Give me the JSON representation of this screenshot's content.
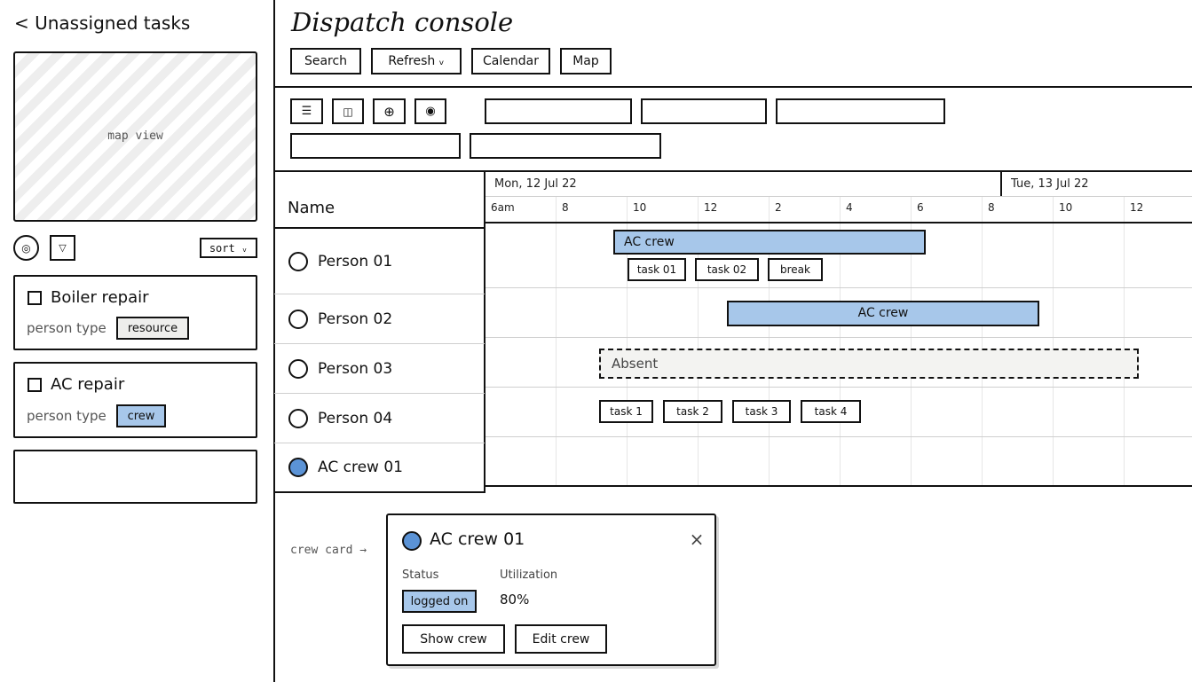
{
  "left": {
    "title": "< Unassigned tasks",
    "map_label": "map view",
    "sort_label": "sort ᵥ",
    "tasks": [
      {
        "name": "Boiler repair",
        "field_label": "person type",
        "tag": "resource",
        "tag_color": "#eeeeec"
      },
      {
        "name": "AC repair",
        "field_label": "person type",
        "tag": "crew",
        "tag_color": "#a7c7ea"
      }
    ]
  },
  "header": {
    "title": "Dispatch console",
    "buttons": {
      "search": "Search",
      "refresh": "Refresh ᵥ",
      "calendar": "Calendar",
      "map": "Map"
    }
  },
  "toolbar": {
    "icons": [
      "list-icon",
      "columns-icon",
      "crosshair-icon",
      "target-icon"
    ]
  },
  "gantt": {
    "name_header": "Name",
    "day1": "Mon, 12 Jul 22",
    "day2": "Tue, 13 Jul 22",
    "ticks": [
      "6am",
      "8",
      "10",
      "12",
      "2",
      "4",
      "6",
      "8",
      "10",
      "12"
    ],
    "rows": [
      {
        "name": "Person 01"
      },
      {
        "name": "Person 02"
      },
      {
        "name": "Person 03"
      },
      {
        "name": "Person 04"
      },
      {
        "name": "AC crew 01"
      }
    ],
    "bars": {
      "p1_crew": "AC crew",
      "p2_crew": "AC crew",
      "p3_absent": "Absent"
    },
    "tasks_p1": [
      "task 01",
      "task 02",
      "break"
    ],
    "tasks_p4": [
      "task 1",
      "task 2",
      "task 3",
      "task 4"
    ]
  },
  "popup": {
    "annotation": "crew card →",
    "title": "AC crew 01",
    "status_label": "Status",
    "status_value": "logged on",
    "util_label": "Utilization",
    "util_value": "80%",
    "show_btn": "Show crew",
    "edit_btn": "Edit crew",
    "accent": "#5b93d6"
  }
}
